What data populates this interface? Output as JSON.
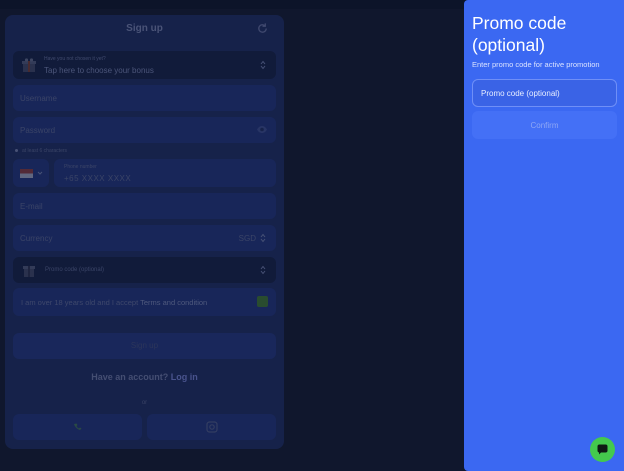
{
  "signup": {
    "title": "Sign up",
    "bonus": {
      "small_label": "Have you not chosen it yet?",
      "main_label": "Tap here to choose your bonus"
    },
    "username_placeholder": "Username",
    "password_placeholder": "Password",
    "password_hint": "at least 6 characters",
    "phone": {
      "label": "Phone number",
      "mask": "+65   XXXX   XXXX"
    },
    "email_placeholder": "E-mail",
    "currency": {
      "label": "Currency",
      "value": "SGD"
    },
    "promo_placeholder": "Promo code (optional)",
    "terms": {
      "prefix": "I am over 18 years old and I accept ",
      "link": "Terms and condition"
    },
    "submit_label": "Sign up",
    "have_account": {
      "text": "Have an account? ",
      "link": "Log in"
    },
    "or_label": "or"
  },
  "promo_panel": {
    "title": "Promo code (optional)",
    "subtitle": "Enter promo code for active promotion",
    "input_placeholder": "Promo code (optional)",
    "confirm_label": "Confirm"
  },
  "icons": {
    "refresh": "refresh-icon",
    "gift": "gift-icon",
    "eye": "eye-icon",
    "flag": "flag-icon",
    "phone": "phone-icon",
    "camera": "camera-icon",
    "chat": "chat-icon"
  },
  "colors": {
    "background": "#141d36",
    "modal": "#1e2d63",
    "field": "#21337a",
    "panel": "#3b68f2",
    "chat_button": "#44c94d"
  }
}
